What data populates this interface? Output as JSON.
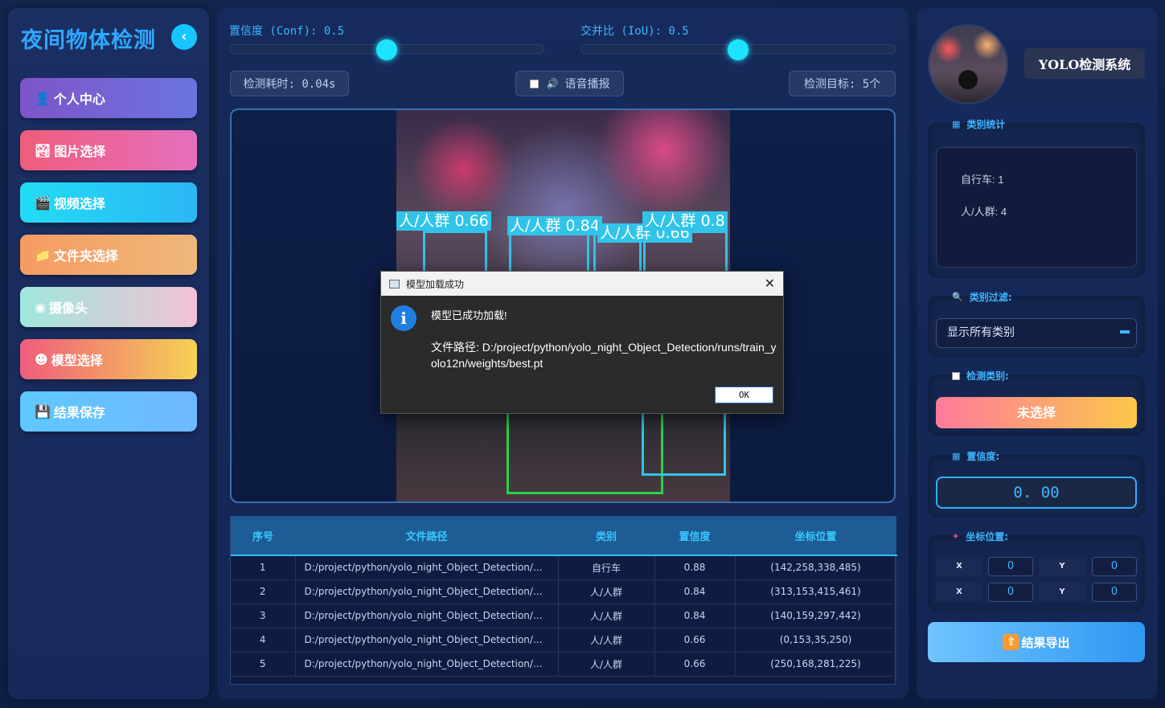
{
  "sidebar": {
    "title": "夜间物体检测",
    "collapse_icon": "chevron-left-icon",
    "items": [
      {
        "icon": "👤",
        "icon_name": "user-icon",
        "label": "个人中心"
      },
      {
        "icon": "🏞",
        "icon_name": "image-icon",
        "label": "图片选择"
      },
      {
        "icon": "🎬",
        "icon_name": "clapper-icon",
        "label": "视频选择"
      },
      {
        "icon": "📁",
        "icon_name": "folder-icon",
        "label": "文件夹选择"
      },
      {
        "icon": "◉",
        "icon_name": "webcam-icon",
        "label": "摄像头"
      },
      {
        "icon": "☻",
        "icon_name": "robot-icon",
        "label": "模型选择"
      },
      {
        "icon": "💾",
        "icon_name": "floppy-icon",
        "label": "结果保存"
      }
    ]
  },
  "controls": {
    "conf_label": "置信度 (Conf): 0.5",
    "conf_value": 0.5,
    "iou_label": "交并比 (IoU): 0.5",
    "iou_value": 0.5,
    "time_label": "检测耗时: 0.04s",
    "voice_label": "语音播报",
    "targets_label": "检测目标: 5个"
  },
  "detections_overlay": [
    {
      "label": "人/人群 0.66"
    },
    {
      "label": "人/人群 0.84"
    },
    {
      "label": "人/人群 0.66"
    },
    {
      "label": "人/人群 0.8"
    }
  ],
  "table": {
    "headers": [
      "序号",
      "文件路径",
      "类别",
      "置信度",
      "坐标位置"
    ],
    "rows": [
      [
        "1",
        "D:/project/python/yolo_night_Object_Detection/...",
        "自行车",
        "0.88",
        "(142,258,338,485)"
      ],
      [
        "2",
        "D:/project/python/yolo_night_Object_Detection/...",
        "人/人群",
        "0.84",
        "(313,153,415,461)"
      ],
      [
        "3",
        "D:/project/python/yolo_night_Object_Detection/...",
        "人/人群",
        "0.84",
        "(140,159,297,442)"
      ],
      [
        "4",
        "D:/project/python/yolo_night_Object_Detection/...",
        "人/人群",
        "0.66",
        "(0,153,35,250)"
      ],
      [
        "5",
        "D:/project/python/yolo_night_Object_Detection/...",
        "人/人群",
        "0.66",
        "(250,168,281,225)"
      ]
    ]
  },
  "right": {
    "system_title": "YOLO检测系统",
    "stats_title": "类别统计",
    "stats": [
      "自行车: 1",
      "人/人群: 4"
    ],
    "filter_title": "类别过滤:",
    "filter_value": "显示所有类别",
    "detect_class_title": "检测类别:",
    "detect_class_value": "未选择",
    "confidence_title": "置信度:",
    "confidence_value": "0. 00",
    "coord_title": "坐标位置:",
    "coords": [
      {
        "label": "X",
        "value": "0"
      },
      {
        "label": "Y",
        "value": "0"
      },
      {
        "label": "X",
        "value": "0"
      },
      {
        "label": "Y",
        "value": "0"
      }
    ],
    "export_label": "结果导出"
  },
  "dialog": {
    "title": "模型加载成功",
    "message": "模型已成功加载!",
    "path": "文件路径: D:/project/python/yolo_night_Object_Detection/runs/train_yolo12n/weights/best.pt",
    "ok_label": "OK"
  },
  "colors": {
    "accent": "#2fa8ff",
    "highlight": "#1ee3ff",
    "bg": "#14254f"
  }
}
